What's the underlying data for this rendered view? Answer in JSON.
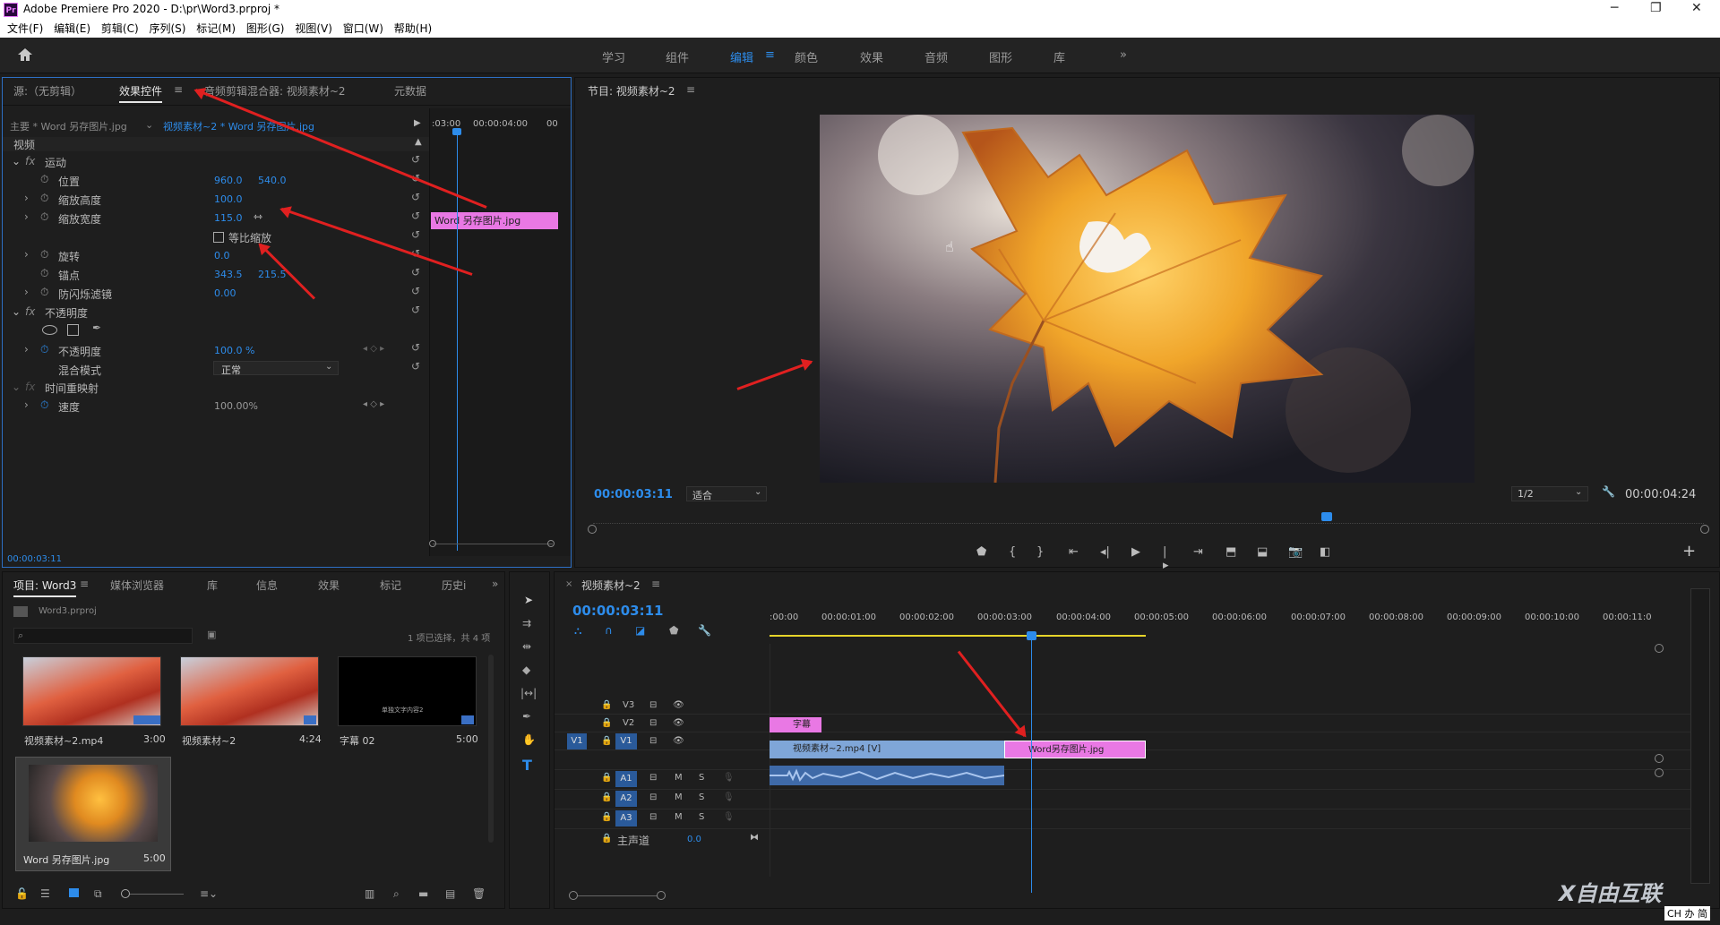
{
  "window": {
    "title": "Adobe Premiere Pro 2020 - D:\\pr\\Word3.prproj *",
    "logo": "Pr",
    "minimize": "─",
    "maximize": "❐",
    "close": "✕"
  },
  "menu": [
    "文件(F)",
    "编辑(E)",
    "剪辑(C)",
    "序列(S)",
    "标记(M)",
    "图形(G)",
    "视图(V)",
    "窗口(W)",
    "帮助(H)"
  ],
  "workspaces": [
    "学习",
    "组件",
    "编辑",
    "颜色",
    "效果",
    "音频",
    "图形",
    "库"
  ],
  "workspace_active": "编辑",
  "effect_panel": {
    "tabs": [
      "源:（无剪辑）",
      "效果控件",
      "音频剪辑混合器: 视频素材~2",
      "元数据"
    ],
    "master": "主要 * Word 另存图片.jpg",
    "sequence_clip": "视频素材~2 * Word 另存图片.jpg",
    "ruler_start": ":03:00",
    "ruler_mid": "00:00:04:00",
    "ruler_end": "00",
    "mini_clip": "Word 另存图片.jpg",
    "section_video": "视频",
    "motion": "运动",
    "position": "位置",
    "pos_x": "960.0",
    "pos_y": "540.0",
    "scale_h": "缩放高度",
    "scale_h_val": "100.0",
    "scale_w": "缩放宽度",
    "scale_w_val": "115.0",
    "uniform": "等比缩放",
    "rotation": "旋转",
    "rotation_val": "0.0",
    "anchor": "锚点",
    "anchor_x": "343.5",
    "anchor_y": "215.5",
    "flicker": "防闪烁滤镜",
    "flicker_val": "0.00",
    "opacity_group": "不透明度",
    "opacity": "不透明度",
    "opacity_val": "100.0 %",
    "blend": "混合模式",
    "blend_val": "正常",
    "time_remap": "时间重映射",
    "speed": "速度",
    "speed_val": "100.00%",
    "timecode": "00:00:03:11"
  },
  "program": {
    "title": "节目: 视频素材~2",
    "timecode": "00:00:03:11",
    "fit": "适合",
    "quality": "1/2",
    "duration": "00:00:04:24"
  },
  "project": {
    "tabs": [
      "项目: Word3",
      "媒体浏览器",
      "库",
      "信息",
      "效果",
      "标记",
      "历史i"
    ],
    "file": "Word3.prproj",
    "selection": "1 项已选择，共 4 项",
    "items": [
      {
        "name": "视频素材~2.mp4",
        "dur": "3:00"
      },
      {
        "name": "视频素材~2",
        "dur": "4:24"
      },
      {
        "name": "字幕 02",
        "dur": "5:00",
        "caption": "单独文字内容2"
      },
      {
        "name": "Word 另存图片.jpg",
        "dur": "5:00"
      }
    ]
  },
  "timeline": {
    "title": "视频素材~2",
    "timecode": "00:00:03:11",
    "ruler": [
      ":00:00",
      "00:00:01:00",
      "00:00:02:00",
      "00:00:03:00",
      "00:00:04:00",
      "00:00:05:00",
      "00:00:06:00",
      "00:00:07:00",
      "00:00:08:00",
      "00:00:09:00",
      "00:00:10:00",
      "00:00:11:0"
    ],
    "tracks": [
      "V3",
      "V2",
      "V1",
      "A1",
      "A2",
      "A3"
    ],
    "src_v1": "V1",
    "master": "主声道",
    "master_val": "0.0",
    "clip_caption": "字幕",
    "clip_video": "视频素材~2.mp4 [V]",
    "clip_image": "Word另存图片.jpg"
  },
  "watermark": {
    "brand": "X自由互联",
    "ime": "CH 办 简"
  },
  "colors": {
    "accent": "#2d8ceb",
    "clip_pink": "#e978e4",
    "clip_blue": "#7fa6d8",
    "arrow": "#e02020"
  }
}
